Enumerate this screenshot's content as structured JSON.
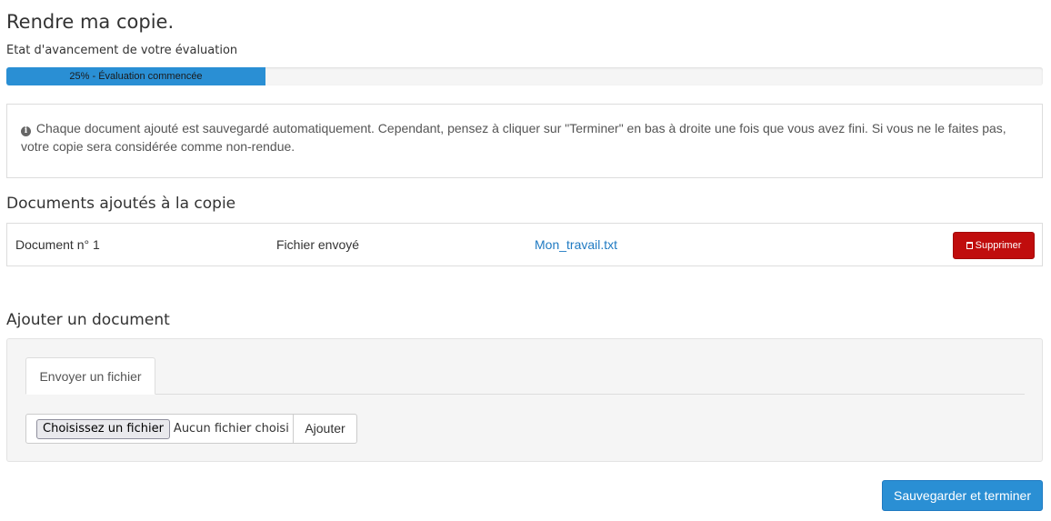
{
  "page": {
    "title": "Rendre ma copie."
  },
  "progress": {
    "label": "Etat d'avancement de votre évaluation",
    "value": 0.25,
    "text": "25% - Évaluation commencée",
    "color": "#2a8fd4"
  },
  "info": {
    "icon": "info-circle-icon",
    "text": "Chaque document ajouté est sauvegardé automatiquement. Cependant, pensez à cliquer sur \"Terminer\" en bas à droite une fois que vous avez fini. Si vous ne le faites pas, votre copie sera considérée comme non-rendue."
  },
  "documents": {
    "title": "Documents ajoutés à la copie",
    "rows": [
      {
        "name": "Document n° 1",
        "type": "Fichier envoyé",
        "file": "Mon_travail.txt",
        "delete_label": "Supprimer",
        "delete_icon": "trash-icon"
      }
    ]
  },
  "add_document": {
    "title": "Ajouter un document",
    "tab_label": "Envoyer un fichier",
    "choose_label": "Choisissez un fichier",
    "no_file_label": "Aucun fichier choisi",
    "add_label": "Ajouter"
  },
  "footer": {
    "save_label": "Sauvegarder et terminer"
  },
  "colors": {
    "primary": "#2a8fd4",
    "danger": "#c00d0d",
    "link": "#1f7ac2"
  }
}
